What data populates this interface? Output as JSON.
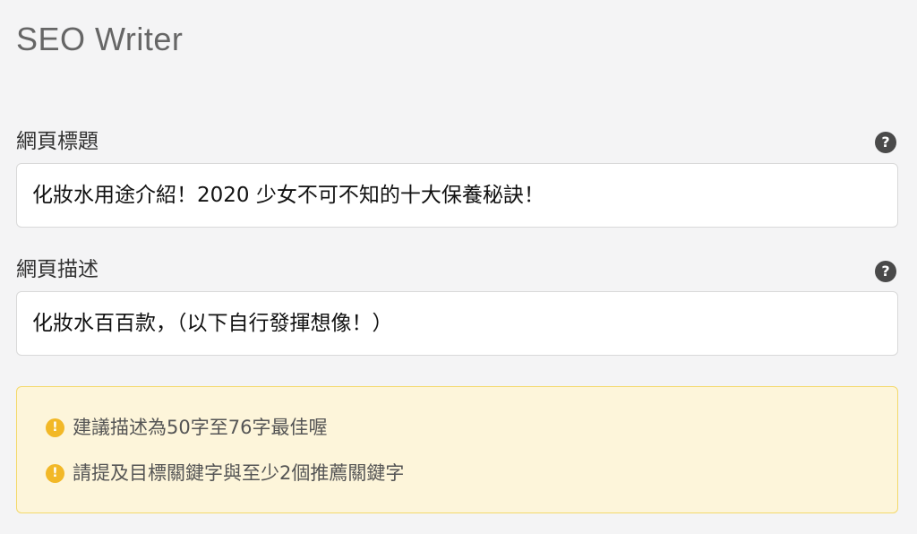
{
  "app": {
    "title": "SEO Writer"
  },
  "fields": {
    "page_title": {
      "label": "網頁標題",
      "value": "化妝水用途介紹！2020 少女不可不知的十大保養秘訣！",
      "help_icon": "question-circle-icon"
    },
    "page_description": {
      "label": "網頁描述",
      "value": "化妝水百百款，（以下自行發揮想像！）",
      "help_icon": "question-circle-icon"
    }
  },
  "tips": {
    "icon": "exclamation-circle-icon",
    "icon_color": "#f2b827",
    "background": "#fdf5da",
    "items": [
      {
        "text": "建議描述為50字至76字最佳喔"
      },
      {
        "text": "請提及目標關鍵字與至少2個推薦關鍵字"
      }
    ]
  }
}
